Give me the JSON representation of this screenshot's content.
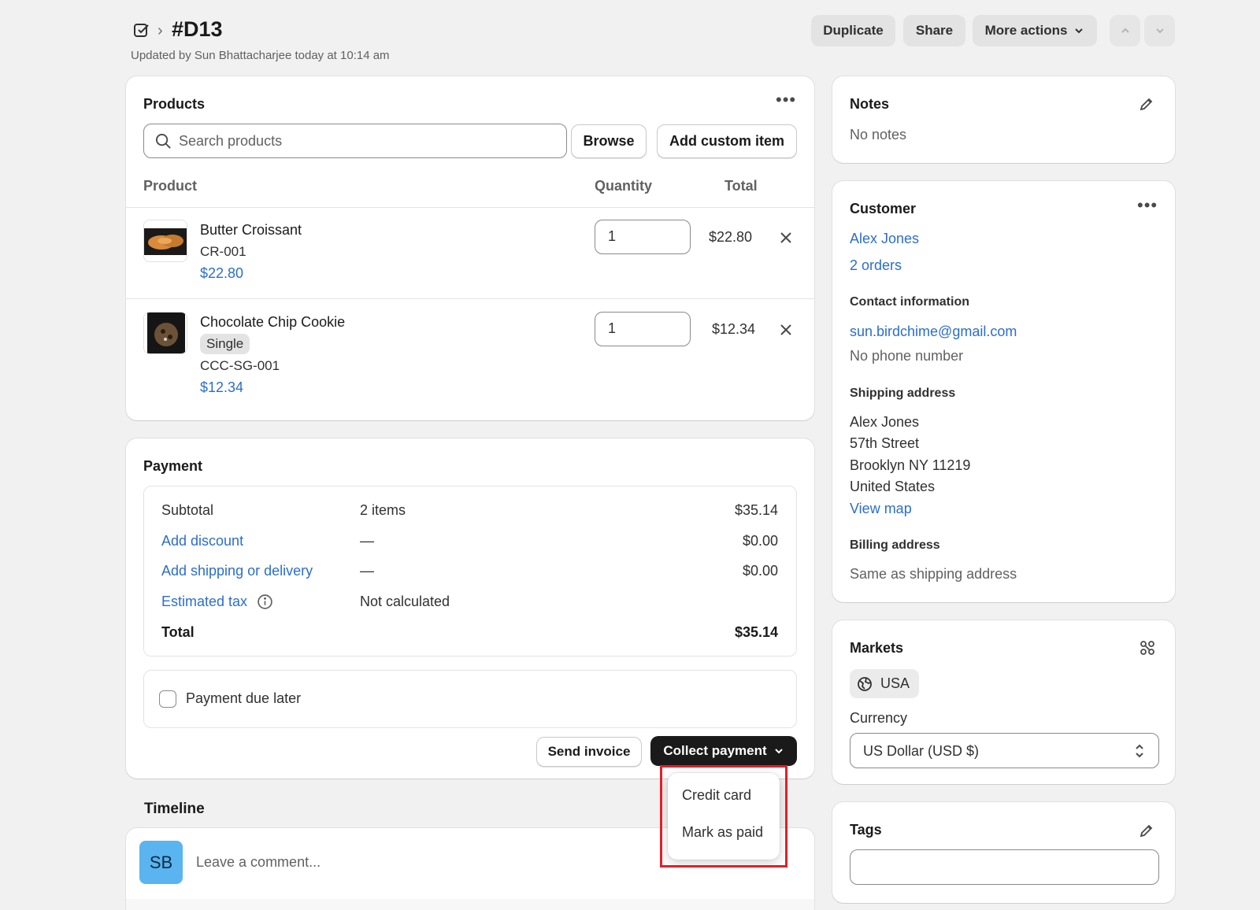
{
  "header": {
    "order_id": "#D13",
    "breadcrumb_sep": "›",
    "updated_text": "Updated by Sun Bhattacharjee today at 10:14 am",
    "duplicate_label": "Duplicate",
    "share_label": "Share",
    "more_actions_label": "More actions"
  },
  "products": {
    "title": "Products",
    "search_placeholder": "Search products",
    "browse_label": "Browse",
    "add_custom_label": "Add custom item",
    "columns": [
      "Product",
      "Quantity",
      "Total"
    ],
    "items": [
      {
        "name": "Butter Croissant",
        "sku": "CR-001",
        "price": "$22.80",
        "quantity": "1",
        "total": "$22.80",
        "variant": ""
      },
      {
        "name": "Chocolate Chip Cookie",
        "variant": "Single",
        "sku": "CCC-SG-001",
        "price": "$12.34",
        "quantity": "1",
        "total": "$12.34"
      }
    ]
  },
  "payment": {
    "title": "Payment",
    "rows": [
      {
        "label": "Subtotal",
        "middle": "2 items",
        "value": "$35.14"
      },
      {
        "label": "Add discount",
        "middle": "—",
        "value": "$0.00"
      },
      {
        "label": "Add shipping or delivery",
        "middle": "—",
        "value": "$0.00"
      },
      {
        "label": "Estimated tax",
        "middle": "Not calculated",
        "value": ""
      },
      {
        "label": "Total",
        "middle": "",
        "value": "$35.14"
      }
    ],
    "due_later_label": "Payment due later",
    "send_invoice_label": "Send invoice",
    "collect_label": "Collect payment",
    "menu_items": [
      "Credit card",
      "Mark as paid"
    ]
  },
  "timeline": {
    "title": "Timeline",
    "avatar_initials": "SB",
    "comment_placeholder": "Leave a comment..."
  },
  "notes": {
    "title": "Notes",
    "text": "No notes"
  },
  "customer": {
    "title": "Customer",
    "name": "Alex Jones",
    "orders": "2 orders",
    "contact_heading": "Contact information",
    "email": "sun.birdchime@gmail.com",
    "phone": "No phone number",
    "shipping_heading": "Shipping address",
    "shipping_lines": [
      "Alex Jones",
      "57th Street",
      "Brooklyn NY 11219",
      "United States"
    ],
    "view_map": "View map",
    "billing_heading": "Billing address",
    "billing_text": "Same as shipping address"
  },
  "markets": {
    "title": "Markets",
    "market": "USA",
    "currency_label": "Currency",
    "currency_value": "US Dollar (USD $)"
  },
  "tags": {
    "title": "Tags"
  },
  "colors": {
    "link": "#2c6ecb",
    "primary_button": "#1a1a1a",
    "highlight": "#e0202a",
    "avatar": "#5ab4f0"
  }
}
